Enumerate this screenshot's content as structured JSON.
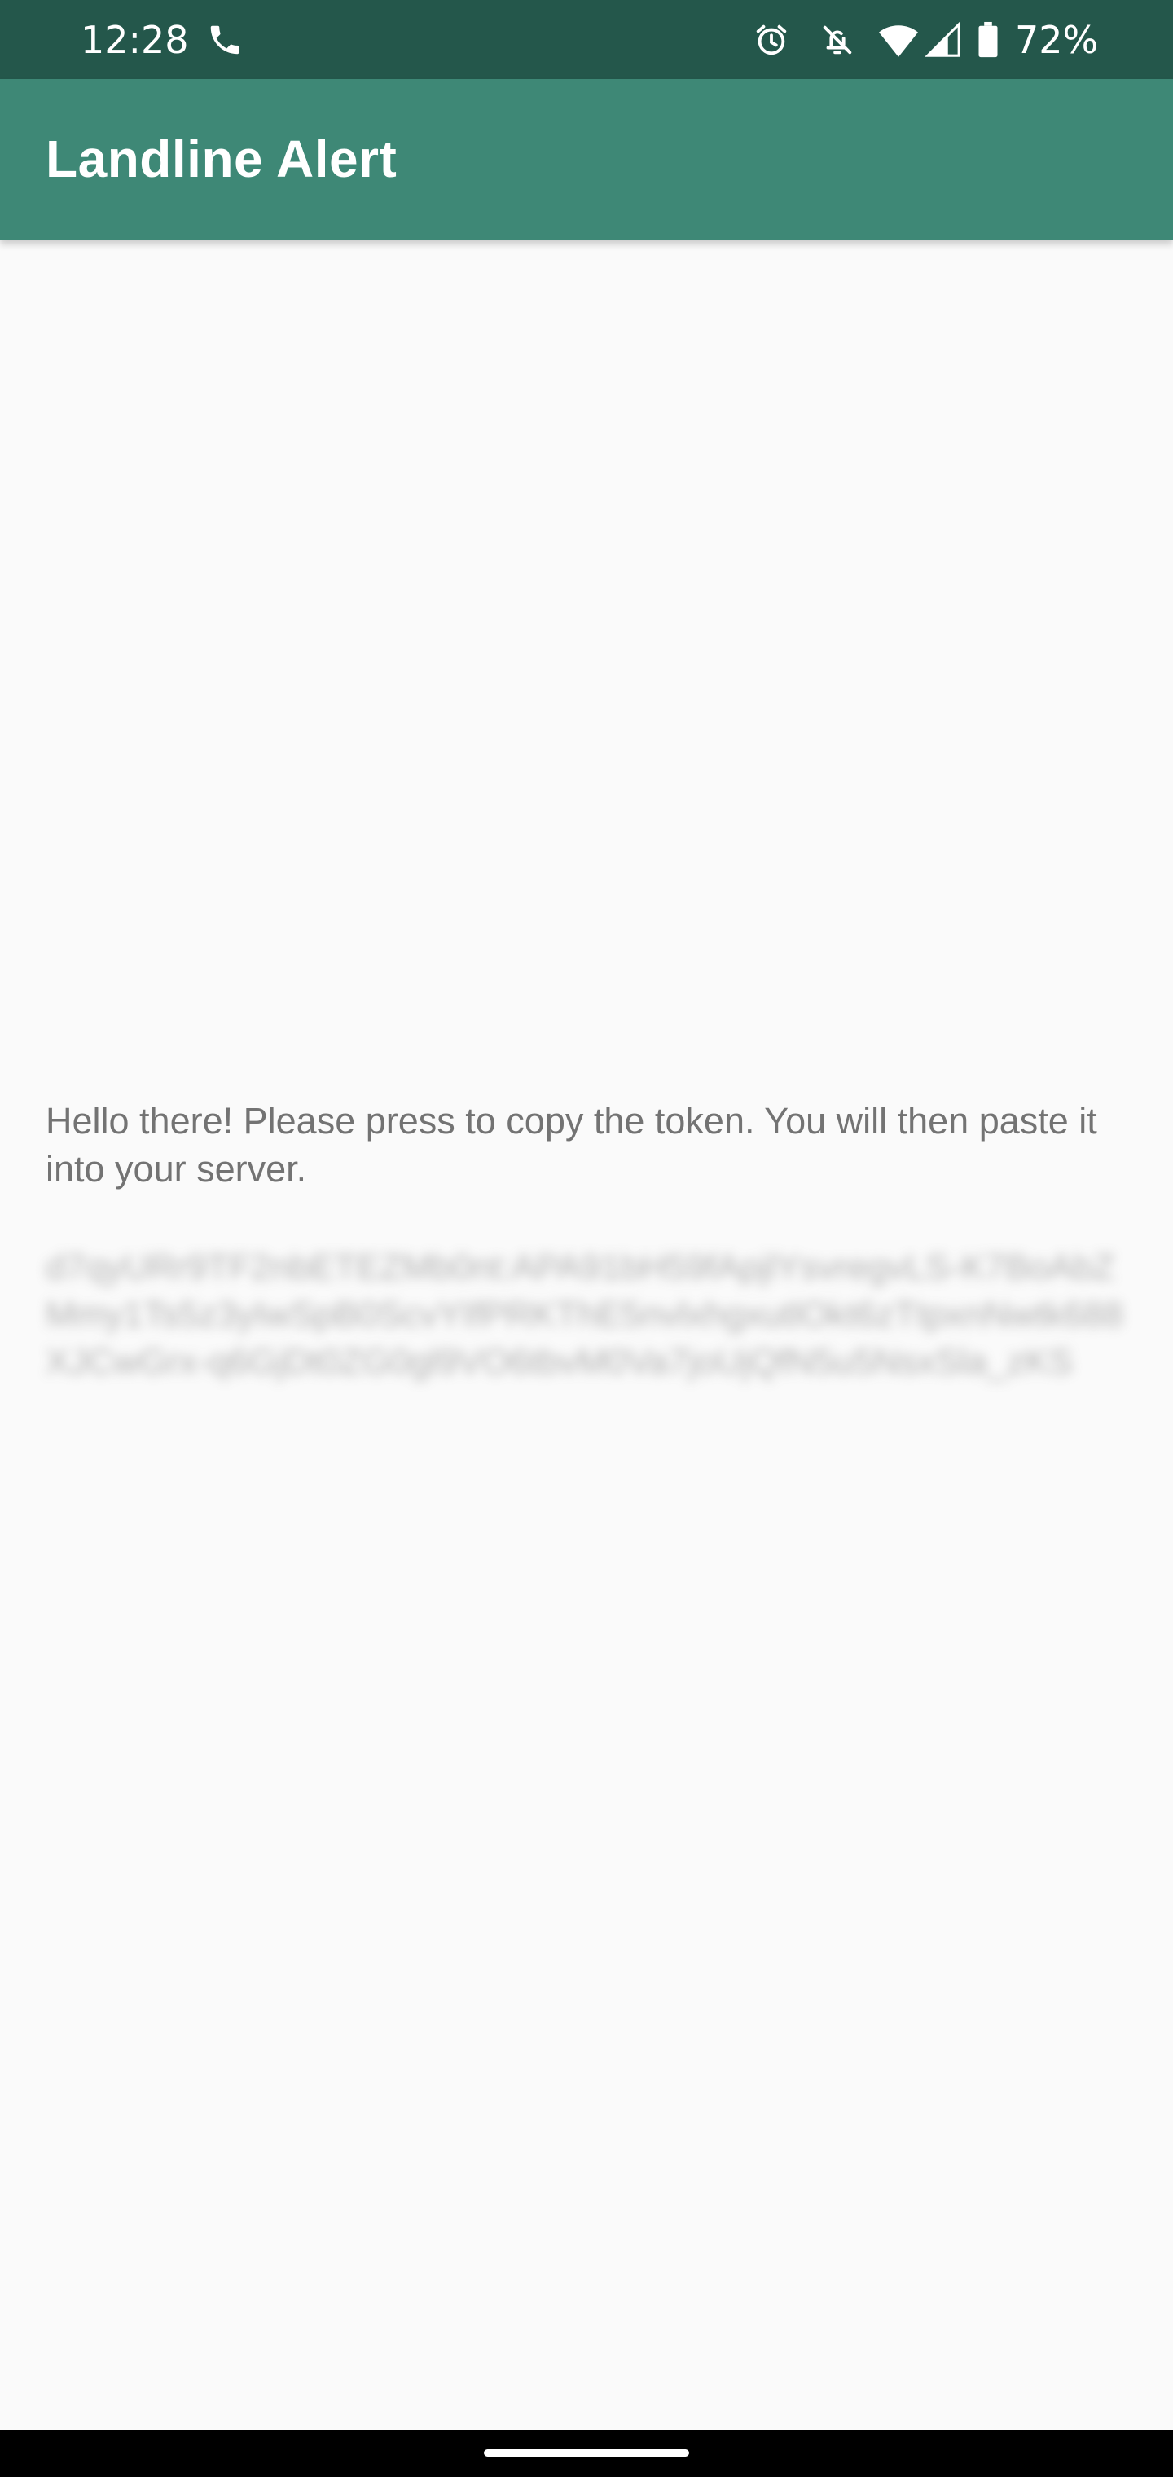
{
  "status_bar": {
    "time": "12:28",
    "battery_percent": "72%",
    "icons": [
      "phone-call-icon",
      "alarm-icon",
      "notifications-off-icon",
      "wifi-icon",
      "cellular-signal-icon",
      "battery-icon"
    ],
    "background_color": "#24574b"
  },
  "app_bar": {
    "title": "Landline Alert",
    "background_color": "#3e8876"
  },
  "content": {
    "message": "Hello there! Please press to copy the token. You will then paste it into your server.",
    "token": "d7qyURr9TF2nbETEZMb0nt:APA91bH59fApjlYsvregvLS-K7BoAbZMmy1Ts5z3yIwSpB0ScvYIfPRKThE5nvlxhgxutlOkt6zTtpxnNwtk688XJCwGrx-q6GjDt0ZG0gl9VO6tbvM0Va7joUjQfN5u5NsxSla_zKS"
  },
  "nav_bar": {
    "handle": "home-handle"
  }
}
